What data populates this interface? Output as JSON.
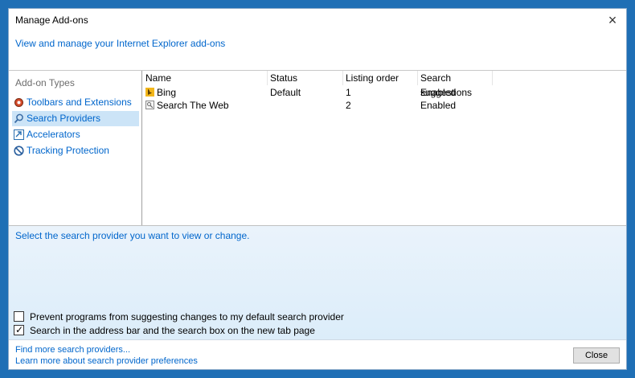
{
  "window": {
    "title": "Manage Add-ons",
    "close_glyph": "×"
  },
  "header": {
    "link": "View and manage your Internet Explorer add-ons"
  },
  "left_pane": {
    "heading": "Add-on Types",
    "items": [
      {
        "label": "Toolbars and Extensions",
        "icon": "gear-icon",
        "selected": false
      },
      {
        "label": "Search Providers",
        "icon": "search-icon",
        "selected": true
      },
      {
        "label": "Accelerators",
        "icon": "accelerator-icon",
        "selected": false
      },
      {
        "label": "Tracking Protection",
        "icon": "block-icon",
        "selected": false
      }
    ]
  },
  "list": {
    "columns": [
      "Name",
      "Status",
      "Listing order",
      "Search suggestions"
    ],
    "rows": [
      {
        "name": "Bing",
        "status": "Default",
        "order": "1",
        "suggestions": "Enabled",
        "icon": "bing-icon"
      },
      {
        "name": "Search The Web",
        "status": "",
        "order": "2",
        "suggestions": "Enabled",
        "icon": "web-page-icon"
      }
    ]
  },
  "detail": {
    "prompt": "Select the search provider you want to view or change.",
    "checkboxes": [
      {
        "label": "Prevent programs from suggesting changes to my default search provider",
        "checked": false
      },
      {
        "label": "Search in the address bar and the search box on the new tab page",
        "checked": true
      }
    ],
    "check_glyph": "✓"
  },
  "footer": {
    "link1": "Find more search providers...",
    "link2": "Learn more about search provider preferences",
    "close_label": "Close"
  },
  "colors": {
    "link": "#0066cc",
    "selection": "#cce4f7",
    "detail_bg": "#dcedfa",
    "frame": "#1f6fb5"
  }
}
